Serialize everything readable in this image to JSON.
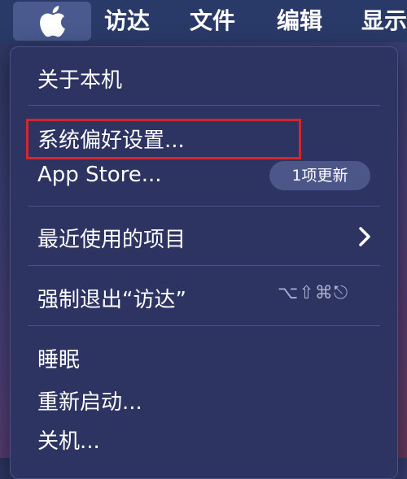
{
  "menubar": {
    "items": [
      "访达",
      "文件",
      "编辑",
      "显示"
    ]
  },
  "apple_menu": {
    "about": "关于本机",
    "system_preferences": "系统偏好设置...",
    "app_store": "App Store...",
    "app_store_badge": "1项更新",
    "recent_items": "最近使用的项目",
    "force_quit": "强制退出“访达”",
    "force_quit_shortcut": "⌥⇧⌘⎋",
    "sleep": "睡眠",
    "restart": "重新启动...",
    "shutdown": "关机..."
  },
  "colors": {
    "highlight_box": "#d6262c",
    "menu_background": "#2d3462"
  }
}
